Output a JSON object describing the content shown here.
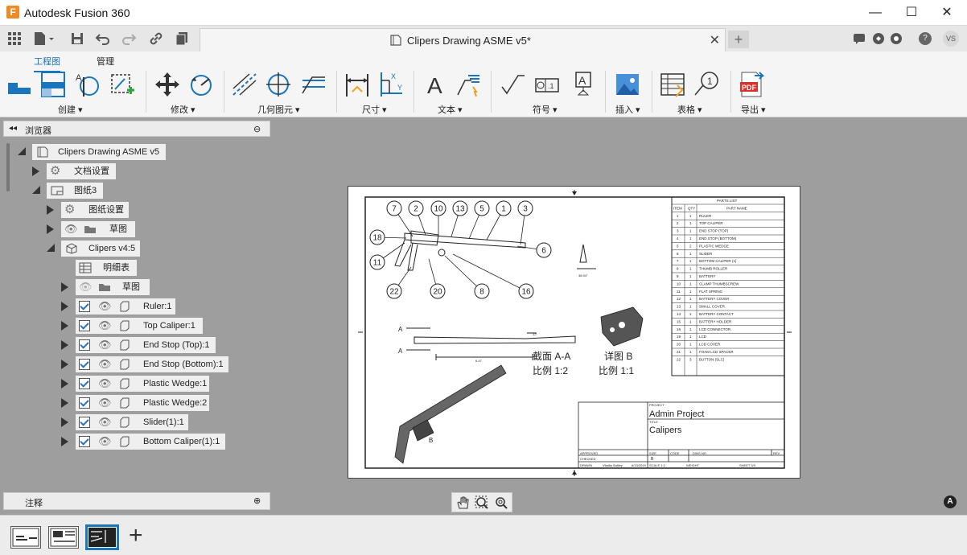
{
  "app": {
    "logo_letter": "F",
    "title": "Autodesk Fusion 360",
    "window_controls": {
      "minimize": "—",
      "maximize": "☐",
      "close": "✕"
    }
  },
  "topbar": {
    "doc_tab_title": "Clipers Drawing ASME v5*",
    "close_glyph": "✕",
    "new_tab_glyph": "+",
    "avatar_initials": "VS",
    "help_glyph": "?"
  },
  "ribbon": {
    "tabs": [
      "工程图",
      "管理"
    ],
    "groups": [
      "创建 ▾",
      "修改 ▾",
      "几何图元 ▾",
      "尺寸 ▾",
      "文本 ▾",
      "符号 ▾",
      "插入 ▾",
      "表格 ▾",
      "导出 ▾"
    ],
    "pdf_label": "PDF"
  },
  "browser": {
    "title": "浏览器",
    "items": [
      {
        "label": "Clipers Drawing ASME v5"
      },
      {
        "label": "文档设置"
      },
      {
        "label": "图纸3"
      },
      {
        "label": "图纸设置"
      },
      {
        "label": "草图"
      },
      {
        "label": "Clipers v4:5"
      },
      {
        "label": "明细表"
      },
      {
        "label": "草图"
      },
      {
        "label": "Ruler:1"
      },
      {
        "label": "Top Caliper:1"
      },
      {
        "label": "End Stop (Top):1"
      },
      {
        "label": "End Stop (Bottom):1"
      },
      {
        "label": "Plastic Wedge:1"
      },
      {
        "label": "Plastic Wedge:2"
      },
      {
        "label": "Slider(1):1"
      },
      {
        "label": "Bottom Caliper(1):1"
      }
    ],
    "annotation_title": "注释"
  },
  "sheet": {
    "parts_list_title": "PARTS LIST",
    "parts_headers": [
      "ITEM",
      "QTY",
      "PART NAME"
    ],
    "parts": [
      [
        "1",
        "1",
        "RULER"
      ],
      [
        "2",
        "1",
        "TOP CALIPER"
      ],
      [
        "3",
        "1",
        "END STOP (TOP)"
      ],
      [
        "4",
        "1",
        "END STOP (BOTTOM)"
      ],
      [
        "5",
        "2",
        "PLASTIC WEDGE"
      ],
      [
        "6",
        "1",
        "SLIDER"
      ],
      [
        "7",
        "1",
        "BOTTOM CALIPER (1)"
      ],
      [
        "8",
        "1",
        "THUMB ROLLER"
      ],
      [
        "9",
        "1",
        "BATTERY"
      ],
      [
        "10",
        "1",
        "CLAMP THUMBSCREW"
      ],
      [
        "11",
        "1",
        "FLAT SPRING"
      ],
      [
        "12",
        "1",
        "BATTERY COVER"
      ],
      [
        "13",
        "1",
        "SMALL COVER"
      ],
      [
        "14",
        "1",
        "BATTERY CONTACT"
      ],
      [
        "15",
        "1",
        "BATTERY HOLDER"
      ],
      [
        "16",
        "1",
        "LCD CONNECTOR"
      ],
      [
        "19",
        "1",
        "LCD"
      ],
      [
        "20",
        "1",
        "LCD COVER"
      ],
      [
        "21",
        "1",
        "FOAM LCD SPACER"
      ],
      [
        "22",
        "3",
        "BUTTON (SLC)"
      ]
    ],
    "balloons": [
      "7",
      "2",
      "10",
      "13",
      "5",
      "1",
      "3",
      "18",
      "6",
      "11",
      "22",
      "20",
      "8",
      "16"
    ],
    "angle_label": "38.94°",
    "section_label_1": "截面 A-A",
    "section_label_2": "比例 1:2",
    "detail_label_1": "详图 B",
    "detail_label_2": "比例 1:1",
    "dim_1": "6.47",
    "dim_2": ".12",
    "section_marker": "A",
    "detail_marker": "B",
    "project_caption": "PROJECT",
    "project": "Admin Project",
    "title_caption": "TITLE",
    "title": "Calipers",
    "approved": "APPROVED",
    "checked": "CHECKED",
    "drawn": "DRAWN",
    "drawn_by": "Vitaliia Safiley",
    "drawn_date": "6/13/2019",
    "size_caption": "SIZE",
    "size": "B",
    "code_caption": "CODE",
    "dwg_caption": "DWG NO",
    "rev_caption": "REV",
    "scale": "SCALE 1:2",
    "weight": "WEIGHT",
    "sheet_no": "SHEET 3/3"
  },
  "statusbar": {
    "nav_icons": [
      "pan-icon",
      "zoom-window-icon",
      "zoom-icon"
    ],
    "add_sheet": "+",
    "badge": "A"
  }
}
